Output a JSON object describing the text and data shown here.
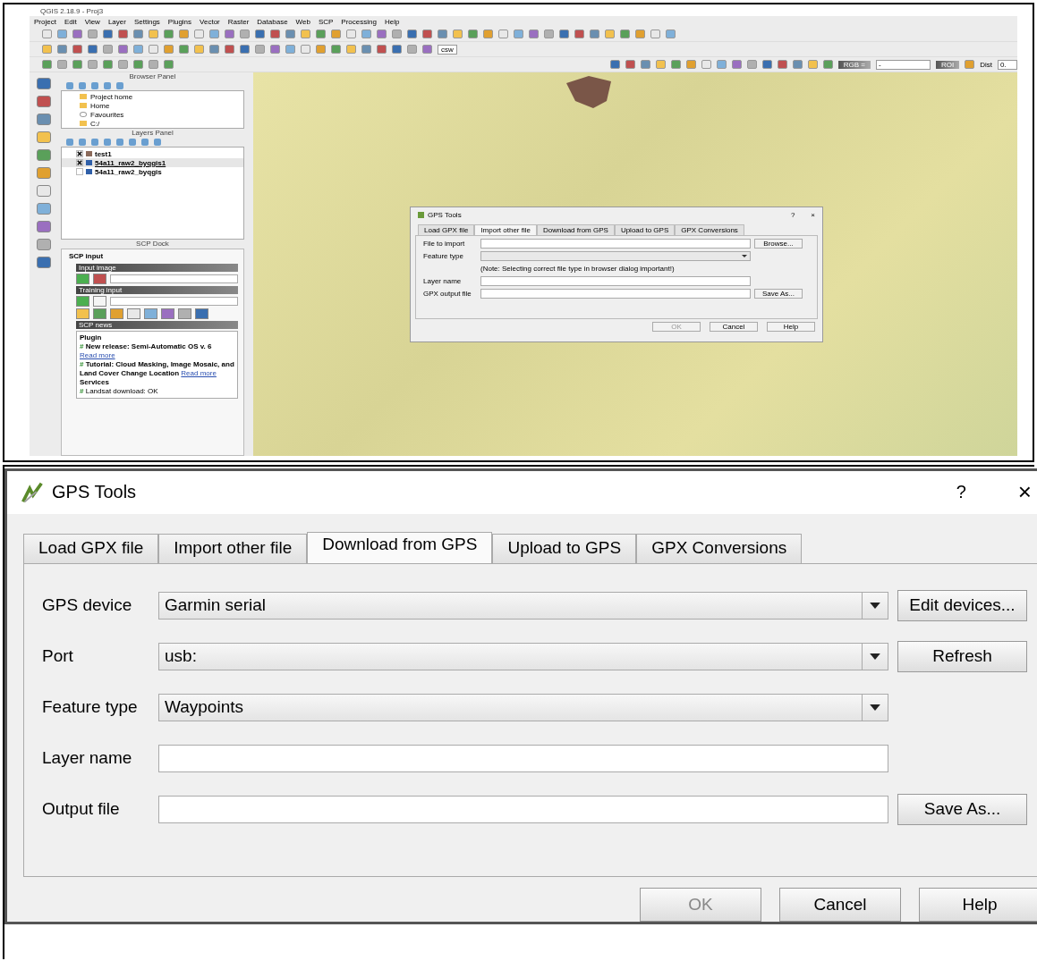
{
  "qgis": {
    "title": "QGIS 2.18.9 - Proj3",
    "menu": [
      "Project",
      "Edit",
      "View",
      "Layer",
      "Settings",
      "Plugins",
      "Vector",
      "Raster",
      "Database",
      "Web",
      "SCP",
      "Processing",
      "Help"
    ],
    "toolbar_texts": {
      "csw": "csw",
      "rgb": "RGB =",
      "band": "-",
      "roi": "ROI",
      "dist": "Dist",
      "dist_value": "0."
    },
    "browser_panel": {
      "title": "Browser Panel",
      "items": [
        {
          "label": "Project home",
          "kind": "folder"
        },
        {
          "label": "Home",
          "kind": "folder"
        },
        {
          "label": "Favourites",
          "kind": "star"
        },
        {
          "label": "C:/",
          "kind": "folder"
        }
      ]
    },
    "layers_panel": {
      "title": "Layers Panel",
      "layers": [
        {
          "name": "test1",
          "checked": true,
          "color": "#8b6a5a",
          "selected": false
        },
        {
          "name": "54a11_raw2_byqgis1",
          "checked": true,
          "color": "#2f5fa8",
          "selected": true
        },
        {
          "name": "54a11_raw2_byqgis",
          "checked": false,
          "color": "#2f5fa8",
          "selected": false
        }
      ]
    },
    "scp_dock": {
      "title": "SCP Dock",
      "tab": "SCP input",
      "input_image": "Input image",
      "training_input": "Training input",
      "news_title": "SCP news",
      "news": [
        {
          "kind": "heading",
          "text": "Plugin"
        },
        {
          "kind": "item",
          "bullet": "#",
          "text": "New release: Semi-Automatic OS v. 6",
          "link": "Read more"
        },
        {
          "kind": "item",
          "bullet": "#",
          "text": "Tutorial: Cloud Masking, Image Mosaic, and Land Cover Change Location",
          "link": "Read more"
        },
        {
          "kind": "heading",
          "text": "Services"
        },
        {
          "kind": "status",
          "bullet": "#",
          "text": "Landsat download: OK"
        }
      ]
    },
    "small_dialog": {
      "title": "GPS Tools",
      "help": "?",
      "close": "×",
      "tabs": [
        {
          "label": "Load GPX file",
          "selected": false
        },
        {
          "label": "Import other file",
          "selected": true
        },
        {
          "label": "Download from GPS",
          "selected": false
        },
        {
          "label": "Upload to GPS",
          "selected": false
        },
        {
          "label": "GPX Conversions",
          "selected": false
        }
      ],
      "rows": [
        {
          "label": "File to import",
          "kind": "input",
          "button": "Browse..."
        },
        {
          "label": "Feature type",
          "kind": "select"
        },
        {
          "kind": "note",
          "text": "(Note: Selecting correct file type in browser dialog important!)"
        },
        {
          "label": "Layer name",
          "kind": "input"
        },
        {
          "label": "GPX output file",
          "kind": "input",
          "button": "Save As..."
        }
      ],
      "buttons": [
        {
          "label": "OK",
          "disabled": true
        },
        {
          "label": "Cancel",
          "disabled": false
        },
        {
          "label": "Help",
          "disabled": false
        }
      ]
    }
  },
  "dialog": {
    "title": "GPS Tools",
    "help": "?",
    "close": "×",
    "tabs": [
      {
        "label": "Load GPX file",
        "selected": false
      },
      {
        "label": "Import other file",
        "selected": false
      },
      {
        "label": "Download from GPS",
        "selected": true
      },
      {
        "label": "Upload to GPS",
        "selected": false
      },
      {
        "label": "GPX Conversions",
        "selected": false
      }
    ],
    "rows": [
      {
        "label": "GPS device",
        "kind": "select",
        "value": "Garmin serial",
        "button": "Edit devices..."
      },
      {
        "label": "Port",
        "kind": "select",
        "value": "usb:",
        "button": "Refresh"
      },
      {
        "label": "Feature type",
        "kind": "select",
        "value": "Waypoints"
      },
      {
        "label": "Layer name",
        "kind": "input"
      },
      {
        "label": "Output file",
        "kind": "input",
        "button": "Save As..."
      }
    ],
    "buttons": [
      {
        "label": "OK",
        "disabled": true
      },
      {
        "label": "Cancel",
        "disabled": false
      },
      {
        "label": "Help",
        "disabled": false
      }
    ]
  }
}
